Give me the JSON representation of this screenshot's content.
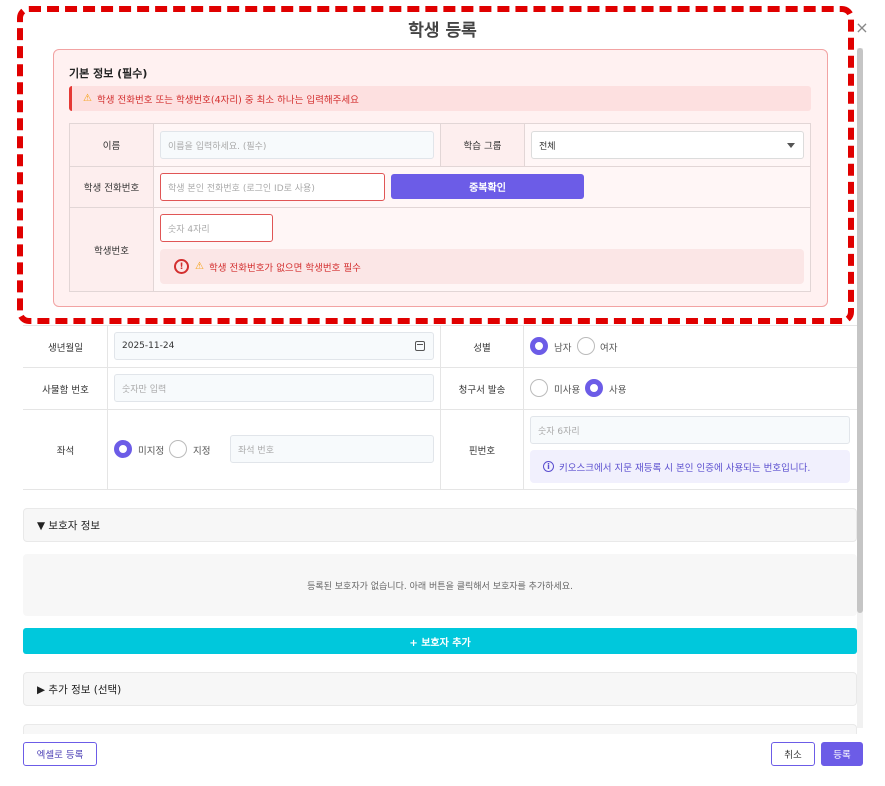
{
  "modal": {
    "title": "학생 등록",
    "close_icon": "×"
  },
  "basic_info": {
    "title": "기본 정보 (필수)",
    "warning_icon": "⚠",
    "warning_text": "학생 전화번호 또는 학생번호(4자리) 중 최소 하나는 입력해주세요",
    "name_label": "이름",
    "name_placeholder": "이름을 입력하세요. (필수)",
    "group_label": "학습 그룹",
    "group_value": "전체",
    "phone_label": "학생 전화번호",
    "phone_placeholder": "학생 본인 전화번호 (로그인 ID로 사용)",
    "dup_check_label": "중복확인",
    "student_no_label": "학생번호",
    "student_no_placeholder": "숫자 4자리",
    "student_no_error_icon": "!",
    "student_no_error": "학생 전화번호가 없으면 학생번호 필수"
  },
  "details": {
    "birth_label": "생년월일",
    "birth_value": "2025-11-24",
    "gender_label": "성별",
    "gender_options": [
      "남자",
      "여자"
    ],
    "gender_selected": "남자",
    "locker_label": "사물함 번호",
    "locker_placeholder": "숫자만 입력",
    "invoice_label": "청구서 발송",
    "invoice_options": [
      "미사용",
      "사용"
    ],
    "invoice_selected": "사용",
    "seat_label": "좌석",
    "seat_options": [
      "미지정",
      "지정"
    ],
    "seat_selected": "미지정",
    "seat_placeholder": "좌석 번호",
    "pin_label": "핀번호",
    "pin_placeholder": "숫자 6자리",
    "pin_info_icon": "i",
    "pin_info": "키오스크에서 지문 재등록 시 본인 인증에 사용되는 번호입니다."
  },
  "guardian": {
    "section_label": "▼ 보호자 정보",
    "empty_text": "등록된 보호자가 없습니다. 아래 버튼을 클릭해서 보호자를 추가하세요.",
    "add_button": "+ 보호자 추가"
  },
  "extra": {
    "section_label": "▶ 추가 정보 (선택)"
  },
  "footer": {
    "excel_button": "엑셀로 등록",
    "cancel_button": "취소",
    "submit_button": "등록"
  },
  "colors": {
    "primary": "#6c5ce7",
    "cyan": "#00c8dc",
    "error": "#d32f2f",
    "highlight_outline": "#e00000"
  }
}
